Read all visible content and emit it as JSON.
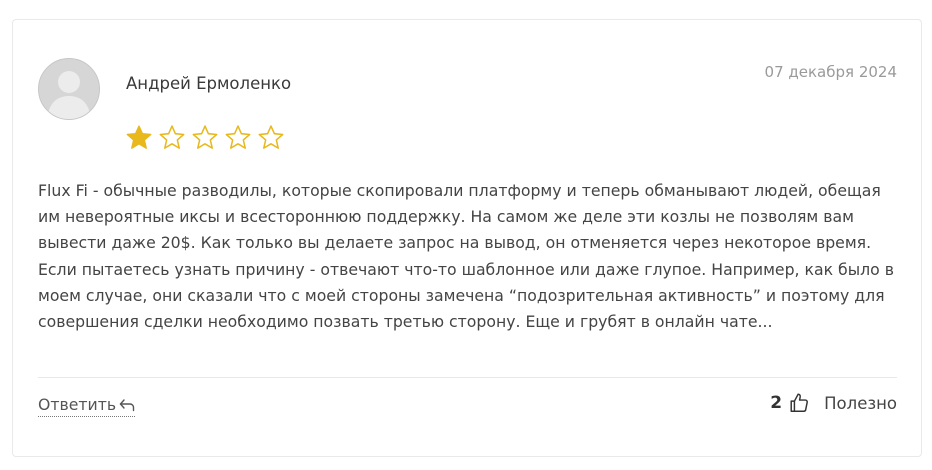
{
  "review": {
    "author": "Андрей Ермоленко",
    "date": "07 декабря 2024",
    "rating": 1,
    "rating_max": 5,
    "text": "Flux Fi - обычные разводилы, которые скопировали платформу и теперь обманывают людей, обещая им невероятные иксы и всестороннюю поддержку. На самом же деле эти козлы не позволям вам вывести даже 20$. Как только вы делаете запрос на вывод, он отменяется через некоторое время. Если пытаетесь узнать причину - отвечают что-то шаблонное или даже глупое. Например, как было в моем случае, они сказали что с моей стороны замечена “подозрительная активность” и поэтому для совершения сделки необходимо позвать третью сторону. Еще и грубят в онлайн чате..."
  },
  "actions": {
    "reply_label": "Ответить",
    "likes_count": "2",
    "helpful_label": "Полезно"
  },
  "icons": {
    "avatar": "user-avatar-placeholder",
    "star_filled": "star-filled-icon",
    "star_empty": "star-outline-icon",
    "reply": "reply-arrow-icon",
    "like": "thumbs-up-icon"
  },
  "colors": {
    "star": "#e8b81c",
    "date": "#9a9a9a",
    "border": "#e9e9e9"
  }
}
